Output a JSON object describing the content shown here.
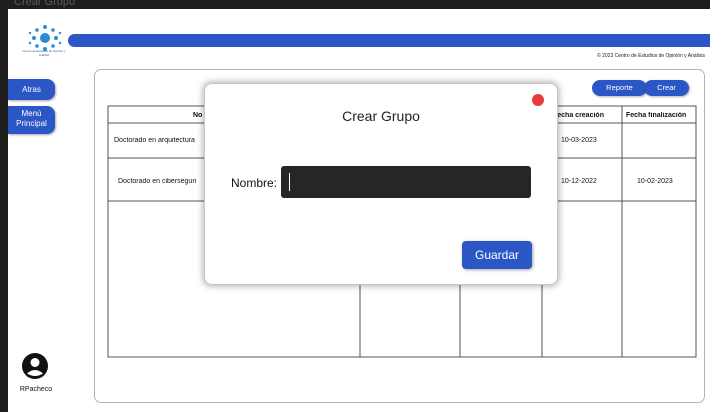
{
  "window": {
    "title": "Crear Grupo"
  },
  "brand": {
    "logo_text": "Centro de Estudios de Opinión y Análisis"
  },
  "header": {
    "copyright": "© 2023 Centro de Estudios de Opinión y Análisis",
    "accent_color": "#2a56c6"
  },
  "sidebar": {
    "back_label": "Atras",
    "menu_label": "Menú Principal",
    "username": "RPacheco"
  },
  "toolbar": {
    "report_label": "Reporte",
    "create_label": "Crear"
  },
  "table": {
    "columns": [
      "No",
      "",
      "",
      "Fecha creación",
      "Fecha finalización"
    ],
    "rows": [
      {
        "name": "Doctorado en arquitectura",
        "created": "10-03-2023",
        "finished": ""
      },
      {
        "name": "Doctorado en ciberseguri",
        "created": "10-12-2022",
        "finished": "10-02-2023"
      }
    ]
  },
  "modal": {
    "title": "Crear Grupo",
    "name_label": "Nombre:",
    "name_value": "",
    "save_label": "Guardar",
    "close_color": "#e83a3a"
  }
}
